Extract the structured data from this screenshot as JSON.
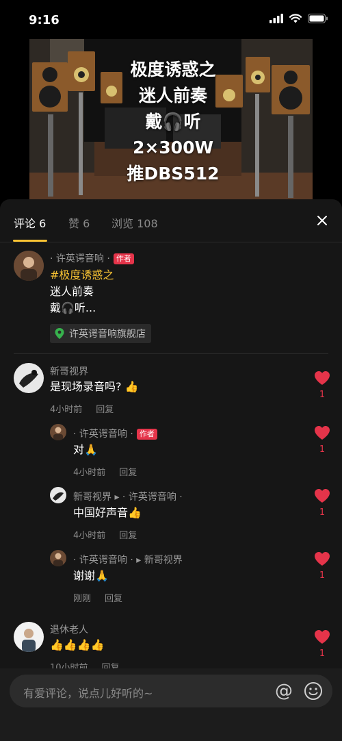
{
  "status_bar": {
    "time": "9:16"
  },
  "video": {
    "overlay_lines": [
      "极度诱惑之",
      "迷人前奏",
      "戴🎧听",
      "2×300W",
      "推DBS512"
    ]
  },
  "tabs": [
    {
      "label": "评论 6"
    },
    {
      "label": "赞 6"
    },
    {
      "label": "浏览 108"
    }
  ],
  "author_post": {
    "name": "· 许英谔音响 ·",
    "badge": "作者",
    "hashtag": "#极度诱惑之",
    "line2": "迷人前奏",
    "line3": "戴🎧听..."
  },
  "store_link": {
    "label": "许英谔音响旗舰店"
  },
  "comments": [
    {
      "name": "新哥视界",
      "text": "是现场录音吗? 👍",
      "time": "4小时前",
      "reply": "回复",
      "likes": "1"
    },
    {
      "name": "· 许英谔音响 ·",
      "badge": "作者",
      "text": "对🙏",
      "time": "4小时前",
      "reply": "回复",
      "likes": "1"
    },
    {
      "name": "新哥视界 ▸ · 许英谔音响 ·",
      "text": "中国好声音👍",
      "time": "4小时前",
      "reply": "回复",
      "likes": "1"
    },
    {
      "name": "· 许英谔音响 · ▸ 新哥视界",
      "text": "谢谢🙏",
      "time": "刚刚",
      "reply": "回复",
      "likes": "1"
    },
    {
      "name": "退休老人",
      "text": "👍👍👍👍",
      "time": "10小时前",
      "reply": "回复",
      "likes": "1"
    }
  ],
  "input": {
    "placeholder": "有爱评论，说点儿好听的~",
    "at_symbol": "@"
  },
  "colors": {
    "accent": "#f7c233",
    "like": "#e5344a",
    "sheet_bg": "#161616"
  }
}
